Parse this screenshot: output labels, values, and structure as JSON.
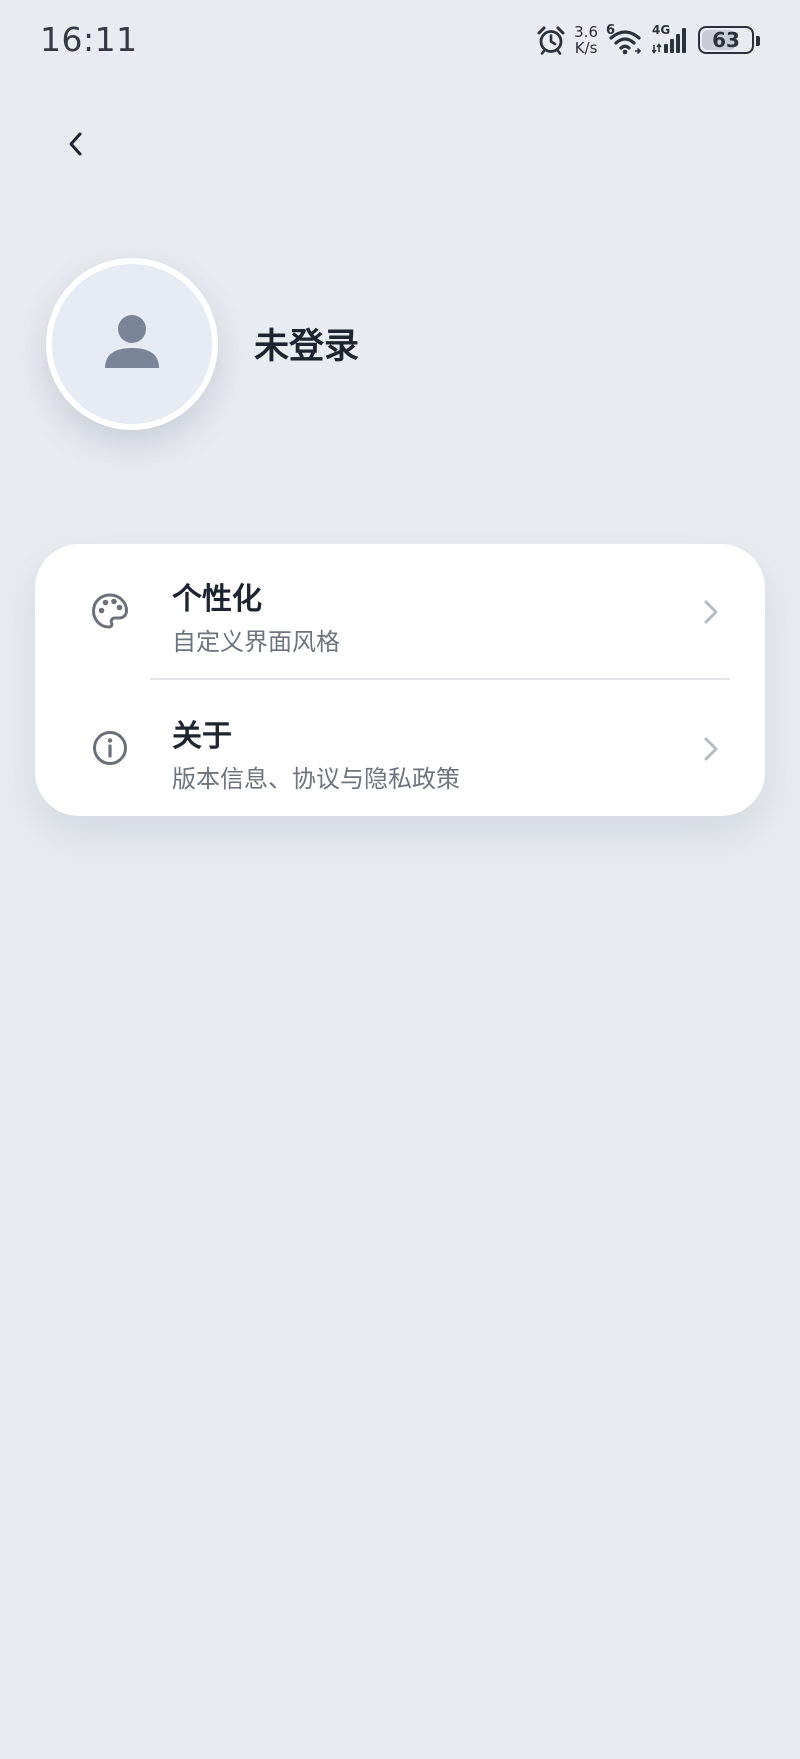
{
  "status_bar": {
    "time": "16:11",
    "net_speed_value": "3.6",
    "net_speed_unit": "K/s",
    "wifi_label": "6",
    "cellular_label": "4G",
    "battery_level": "63",
    "battery_fraction": 0.63,
    "icons": [
      "alarm-icon",
      "wifi-icon",
      "cellular-signal-icon",
      "battery-icon"
    ]
  },
  "header": {
    "back_icon": "chevron-left-icon"
  },
  "profile": {
    "avatar_icon": "person-icon",
    "username": "未登录"
  },
  "menu": {
    "items": [
      {
        "icon": "palette-icon",
        "title": "个性化",
        "subtitle": "自定义界面风格",
        "chevron_icon": "chevron-right-icon"
      },
      {
        "icon": "info-icon",
        "title": "关于",
        "subtitle": "版本信息、协议与隐私政策",
        "chevron_icon": "chevron-right-icon"
      }
    ]
  },
  "colors": {
    "background": "#e8ecf0",
    "card": "#ffffff",
    "text_primary": "#1e2430",
    "text_secondary": "#6e747d",
    "icon_gray": "#6b7079",
    "avatar_bg": "#e7ebf3",
    "avatar_glyph": "#7a8597",
    "chevron": "#b6bac1"
  }
}
